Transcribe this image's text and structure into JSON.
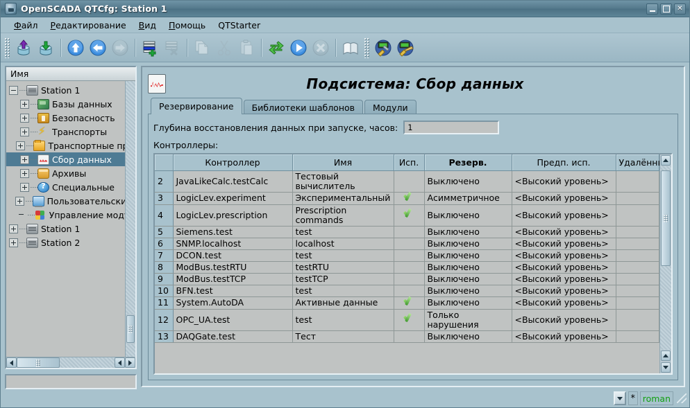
{
  "window": {
    "title": "OpenSCADA QTCfg: Station 1",
    "app_icon": "openscada-icon",
    "buttons": {
      "minimize": "_",
      "maximize": "□",
      "close": "✕"
    }
  },
  "menubar": [
    {
      "label": "Файл",
      "accel": "Ф"
    },
    {
      "label": "Редактирование",
      "accel": "Р"
    },
    {
      "label": "Вид",
      "accel": "В"
    },
    {
      "label": "Помощь",
      "accel": "П"
    },
    {
      "label": "QTStarter",
      "accel": ""
    }
  ],
  "toolbar": [
    {
      "name": "load-from-db-icon",
      "enabled": true
    },
    {
      "name": "save-to-db-icon",
      "enabled": true
    },
    {
      "name": "go-up-icon",
      "enabled": true
    },
    {
      "name": "go-back-icon",
      "enabled": true
    },
    {
      "name": "go-forward-icon",
      "enabled": false
    },
    {
      "name": "add-node-icon",
      "enabled": true
    },
    {
      "name": "delete-node-icon",
      "enabled": false
    },
    {
      "name": "copy-node-icon",
      "enabled": false
    },
    {
      "name": "cut-icon",
      "enabled": false
    },
    {
      "name": "paste-icon",
      "enabled": false
    },
    {
      "name": "refresh-icon",
      "enabled": true
    },
    {
      "name": "start-icon",
      "enabled": true
    },
    {
      "name": "stop-icon",
      "enabled": false
    },
    {
      "name": "manual-icon",
      "enabled": true
    },
    {
      "name": "config-tool-icon",
      "enabled": true
    },
    {
      "name": "config-edit-icon",
      "enabled": true
    }
  ],
  "tree": {
    "header": "Имя",
    "nodes": [
      {
        "label": "Station 1",
        "depth": 0,
        "expander": "minus",
        "icon": "ico-station",
        "selected": false
      },
      {
        "label": "Базы данных",
        "depth": 1,
        "expander": "plus",
        "icon": "ico-db",
        "selected": false
      },
      {
        "label": "Безопасность",
        "depth": 1,
        "expander": "plus",
        "icon": "ico-sec",
        "selected": false
      },
      {
        "label": "Транспорты",
        "depth": 1,
        "expander": "plus",
        "icon": "ico-bolt",
        "selected": false
      },
      {
        "label": "Транспортные протоколы",
        "depth": 1,
        "expander": "plus",
        "icon": "ico-folder",
        "selected": false
      },
      {
        "label": "Сбор данных",
        "depth": 1,
        "expander": "plus",
        "icon": "ico-daq",
        "selected": true
      },
      {
        "label": "Архивы",
        "depth": 1,
        "expander": "plus",
        "icon": "ico-arch",
        "selected": false
      },
      {
        "label": "Специальные",
        "depth": 1,
        "expander": "plus",
        "icon": "ico-spec",
        "selected": false
      },
      {
        "label": "Пользовательские интерфейсы",
        "depth": 1,
        "expander": "plus",
        "icon": "ico-ui",
        "selected": false
      },
      {
        "label": "Управление модулями",
        "depth": 1,
        "expander": "none",
        "icon": "ico-mod",
        "selected": false
      },
      {
        "label": "Station 1",
        "depth": 0,
        "expander": "plus",
        "icon": "ico-station",
        "selected": false
      },
      {
        "label": "Station 2",
        "depth": 0,
        "expander": "plus",
        "icon": "ico-station",
        "selected": false
      }
    ]
  },
  "page": {
    "icon": "daq-wave-icon",
    "title": "Подсистема: Сбор данных",
    "tabs": [
      {
        "label": "Резервирование",
        "active": true
      },
      {
        "label": "Библиотеки шаблонов",
        "active": false
      },
      {
        "label": "Модули",
        "active": false
      }
    ],
    "depth_field": {
      "label": "Глубина восстановления данных при запуске, часов:",
      "value": "1"
    },
    "table_caption": "Контроллеры:"
  },
  "table": {
    "columns": [
      "",
      "Контроллер",
      "Имя",
      "Исп.",
      "Резерв.",
      "Предп. исп.",
      "Удалённый"
    ],
    "bold_columns": [
      "Резерв."
    ],
    "rows": [
      {
        "num": "2",
        "controller": "JavaLikeCalc.testCalc",
        "name": "Тестовый вычислитель",
        "used": false,
        "reserve": "Выключено",
        "pref": "<Высокий уровень>",
        "remote": ""
      },
      {
        "num": "3",
        "controller": "LogicLev.experiment",
        "name": "Экспериментальный",
        "used": true,
        "reserve": "Асимметричное",
        "pref": "<Высокий уровень>",
        "remote": ""
      },
      {
        "num": "4",
        "controller": "LogicLev.prescription",
        "name": "Prescription commands",
        "used": true,
        "reserve": "Выключено",
        "pref": "<Высокий уровень>",
        "remote": ""
      },
      {
        "num": "5",
        "controller": "Siemens.test",
        "name": "test",
        "used": false,
        "reserve": "Выключено",
        "pref": "<Высокий уровень>",
        "remote": ""
      },
      {
        "num": "6",
        "controller": "SNMP.localhost",
        "name": "localhost",
        "used": false,
        "reserve": "Выключено",
        "pref": "<Высокий уровень>",
        "remote": ""
      },
      {
        "num": "7",
        "controller": "DCON.test",
        "name": "test",
        "used": false,
        "reserve": "Выключено",
        "pref": "<Высокий уровень>",
        "remote": ""
      },
      {
        "num": "8",
        "controller": "ModBus.testRTU",
        "name": "testRTU",
        "used": false,
        "reserve": "Выключено",
        "pref": "<Высокий уровень>",
        "remote": ""
      },
      {
        "num": "9",
        "controller": "ModBus.testTCP",
        "name": "testTCP",
        "used": false,
        "reserve": "Выключено",
        "pref": "<Высокий уровень>",
        "remote": ""
      },
      {
        "num": "10",
        "controller": "BFN.test",
        "name": "test",
        "used": false,
        "reserve": "Выключено",
        "pref": "<Высокий уровень>",
        "remote": ""
      },
      {
        "num": "11",
        "controller": "System.AutoDA",
        "name": "Активные данные",
        "used": true,
        "reserve": "Выключено",
        "pref": "<Высокий уровень>",
        "remote": ""
      },
      {
        "num": "12",
        "controller": "OPC_UA.test",
        "name": "test",
        "used": true,
        "reserve": "Только нарушения",
        "pref": "<Высокий уровень>",
        "remote": ""
      },
      {
        "num": "13",
        "controller": "DAQGate.test",
        "name": "Тест",
        "used": false,
        "reserve": "Выключено",
        "pref": "<Высокий уровень>",
        "remote": ""
      }
    ]
  },
  "statusbar": {
    "message": "",
    "combo_icon": "chevron-down-icon",
    "modified_flag": "*",
    "user": "roman",
    "user_color": "#12a012"
  }
}
